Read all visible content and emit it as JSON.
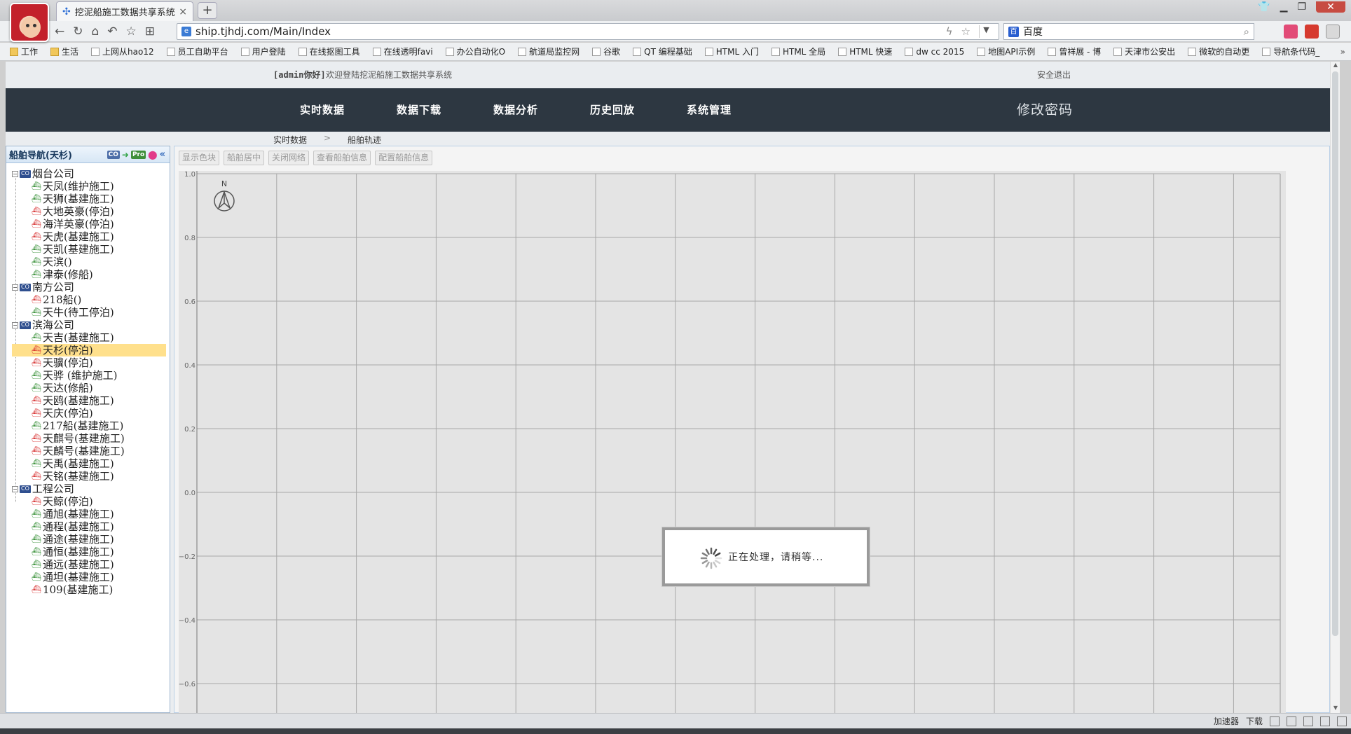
{
  "browser": {
    "tab_title": "挖泥船施工数据共享系统",
    "tab_close": "×",
    "new_tab": "+",
    "url": "ship.tjhdj.com/Main/Index",
    "search_engine": "百度",
    "bookmarks": [
      {
        "label": "工作",
        "type": "folder"
      },
      {
        "label": "生活",
        "type": "folder"
      },
      {
        "label": "上网从hao12",
        "type": "link"
      },
      {
        "label": "员工自助平台",
        "type": "link"
      },
      {
        "label": "用户登陆",
        "type": "link"
      },
      {
        "label": "在线抠图工具",
        "type": "link"
      },
      {
        "label": "在线透明favi",
        "type": "link"
      },
      {
        "label": "办公自动化O",
        "type": "link"
      },
      {
        "label": "航道局监控网",
        "type": "link"
      },
      {
        "label": "谷歌",
        "type": "link"
      },
      {
        "label": "QT 编程基础",
        "type": "link"
      },
      {
        "label": "HTML 入门",
        "type": "link"
      },
      {
        "label": "HTML 全局",
        "type": "link"
      },
      {
        "label": "HTML 快速",
        "type": "link"
      },
      {
        "label": "dw cc 2015",
        "type": "link"
      },
      {
        "label": "地图API示例",
        "type": "link"
      },
      {
        "label": "曾祥展 - 博",
        "type": "link"
      },
      {
        "label": "天津市公安出",
        "type": "link"
      },
      {
        "label": "微软的自动更",
        "type": "link"
      },
      {
        "label": "导航条代码_",
        "type": "link"
      }
    ],
    "bookmarks_more": "»"
  },
  "header": {
    "user": "[admin你好]",
    "welcome": "欢迎登陆挖泥船施工数据共享系统",
    "logout": "安全退出"
  },
  "nav": {
    "items": [
      "实时数据",
      "数据下载",
      "数据分析",
      "历史回放",
      "系统管理"
    ],
    "change_password": "修改密码"
  },
  "breadcrumb": {
    "level1": "实时数据",
    "sep": ">",
    "level2": "船舶轨迹"
  },
  "sidebar": {
    "title": "船舶导航(天杉)",
    "companies": [
      {
        "name": "烟台公司",
        "ships": [
          {
            "label": "天凤(维护施工)",
            "status": "green"
          },
          {
            "label": "天狮(基建施工)",
            "status": "green"
          },
          {
            "label": "大地英豪(停泊)",
            "status": "red"
          },
          {
            "label": "海洋英豪(停泊)",
            "status": "red"
          },
          {
            "label": "天虎(基建施工)",
            "status": "red"
          },
          {
            "label": "天凯(基建施工)",
            "status": "green"
          },
          {
            "label": "天滨()",
            "status": "green"
          },
          {
            "label": "津泰(修船)",
            "status": "green"
          }
        ]
      },
      {
        "name": "南方公司",
        "ships": [
          {
            "label": "218船()",
            "status": "red"
          },
          {
            "label": "天牛(待工停泊)",
            "status": "green"
          }
        ]
      },
      {
        "name": "滨海公司",
        "ships": [
          {
            "label": "天吉(基建施工)",
            "status": "green"
          },
          {
            "label": "天杉(停泊)",
            "status": "red",
            "selected": true
          },
          {
            "label": "天骥(停泊)",
            "status": "red"
          },
          {
            "label": "天骅 (维护施工)",
            "status": "green"
          },
          {
            "label": "天达(修船)",
            "status": "green"
          },
          {
            "label": "天鸥(基建施工)",
            "status": "red"
          },
          {
            "label": "天庆(停泊)",
            "status": "red"
          },
          {
            "label": "217船(基建施工)",
            "status": "green"
          },
          {
            "label": "天麒号(基建施工)",
            "status": "red"
          },
          {
            "label": "天麟号(基建施工)",
            "status": "red"
          },
          {
            "label": "天禹(基建施工)",
            "status": "green"
          },
          {
            "label": "天铭(基建施工)",
            "status": "red"
          }
        ]
      },
      {
        "name": "工程公司",
        "ships": [
          {
            "label": "天鲸(停泊)",
            "status": "red"
          },
          {
            "label": "通旭(基建施工)",
            "status": "green"
          },
          {
            "label": "通程(基建施工)",
            "status": "green"
          },
          {
            "label": "通途(基建施工)",
            "status": "green"
          },
          {
            "label": "通恒(基建施工)",
            "status": "green"
          },
          {
            "label": "通远(基建施工)",
            "status": "green"
          },
          {
            "label": "通坦(基建施工)",
            "status": "green"
          },
          {
            "label": "109(基建施工)",
            "status": "red"
          }
        ]
      }
    ]
  },
  "map_toolbar": {
    "buttons": [
      "显示色块",
      "船舶居中",
      "关闭网络",
      "查看船舶信息",
      "配置船舶信息"
    ]
  },
  "map": {
    "compass_label": "N",
    "y_ticks": [
      "1.0",
      "0.8",
      "0.6",
      "0.4",
      "0.2",
      "0.0",
      "−0.2",
      "−0.4",
      "−0.6"
    ],
    "grid": true
  },
  "loading": {
    "text": "正在处理，请稍等..."
  },
  "statusbar": {
    "accelerator": "加速器",
    "download": "下载"
  },
  "colors": {
    "nav_bg": "#2d3741",
    "selected_bg": "#ffe08c",
    "ship_green": "#2e8b2e",
    "ship_red": "#d62828"
  }
}
